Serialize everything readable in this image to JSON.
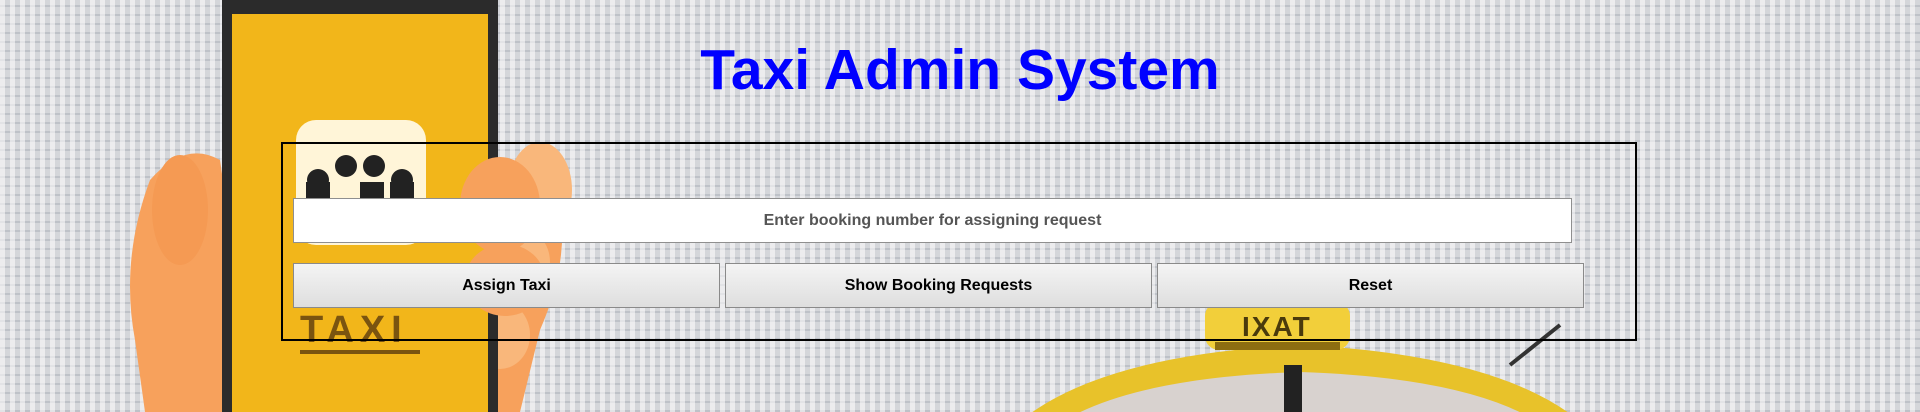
{
  "page": {
    "title": "Taxi Admin System"
  },
  "form": {
    "booking_input": {
      "value": "",
      "placeholder": "Enter booking number for assigning request"
    },
    "buttons": {
      "assign": "Assign Taxi",
      "show_requests": "Show Booking Requests",
      "reset": "Reset"
    }
  },
  "background": {
    "phone_sign_text": "TAXI",
    "roof_sign_text": "IXAT"
  },
  "colors": {
    "title": "#0000ff",
    "taxi_yellow": "#f2b61a",
    "hand": "#f7a15c",
    "background": "#d4d6da"
  }
}
